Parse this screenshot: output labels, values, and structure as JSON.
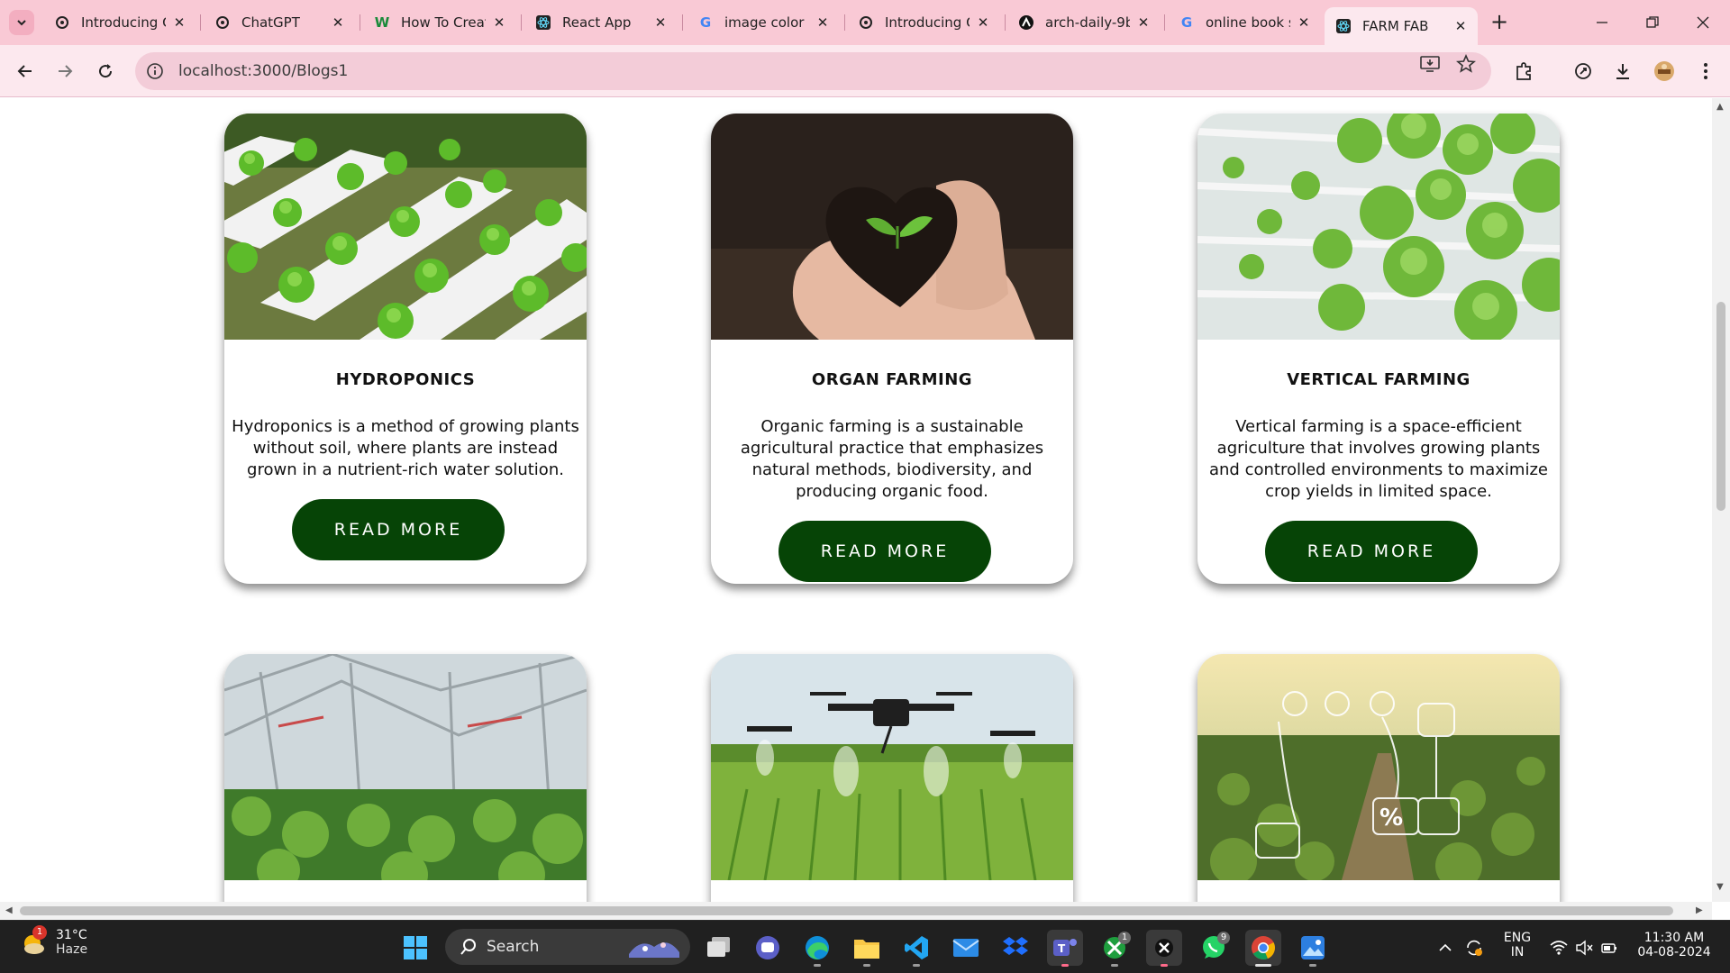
{
  "browser": {
    "tabs": [
      {
        "title": "Introducing C",
        "favicon": "openai-icon",
        "active": false
      },
      {
        "title": "ChatGPT",
        "favicon": "openai-icon",
        "active": false
      },
      {
        "title": "How To Creat",
        "favicon": "w-logo-icon",
        "active": false
      },
      {
        "title": "React App",
        "favicon": "react-icon",
        "active": false
      },
      {
        "title": "image color c",
        "favicon": "google-icon",
        "active": false
      },
      {
        "title": "Introducing C",
        "favicon": "openai-icon",
        "active": false
      },
      {
        "title": "arch-daily-9b",
        "favicon": "arch-icon",
        "active": false
      },
      {
        "title": "online book s",
        "favicon": "google-icon",
        "active": false
      },
      {
        "title": "FARM FAB",
        "favicon": "react-icon",
        "active": true
      }
    ],
    "url": "localhost:3000/Blogs1",
    "colors": {
      "tabstrip": "#f9c9d5",
      "toolbar": "#fce8ee",
      "omnibox": "#f3ccd8"
    }
  },
  "page": {
    "accent": "#064406",
    "cards_row1": [
      {
        "title": "HYDROPONICS",
        "description": "Hydroponics is a method of growing plants without soil, where plants are instead grown in a nutrient-rich water solution.",
        "button": "READ MORE",
        "image": "hydroponics-photo"
      },
      {
        "title": "ORGAN FARMING",
        "description": "Organic farming is a sustainable agricultural practice that emphasizes natural methods, biodiversity, and producing organic food.",
        "button": "READ MORE",
        "image": "soil-heart-photo"
      },
      {
        "title": "VERTICAL FARMING",
        "description": "Vertical farming is a space-efficient agriculture that involves growing plants and controlled environments to maximize crop yields in limited space.",
        "button": "READ MORE",
        "image": "vertical-farm-photo"
      }
    ],
    "cards_row2": [
      {
        "image": "greenhouse-photo"
      },
      {
        "image": "drone-field-photo"
      },
      {
        "image": "smart-farm-photo"
      }
    ]
  },
  "taskbar": {
    "weather": {
      "temp": "31°C",
      "condition": "Haze",
      "badge": "1"
    },
    "search_label": "Search",
    "language": {
      "line1": "ENG",
      "line2": "IN"
    },
    "clock": {
      "time": "11:30 AM",
      "date": "04-08-2024"
    },
    "badges": {
      "xbox": "1",
      "whatsapp": "9"
    }
  }
}
